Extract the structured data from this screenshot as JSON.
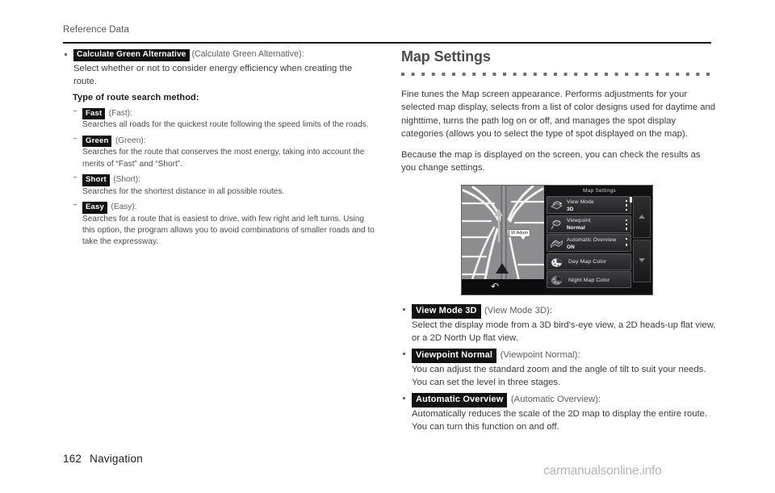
{
  "header": {
    "running_head": "Reference Data"
  },
  "footer": {
    "page_number": "162",
    "section": "Navigation",
    "watermark": "carmanualsonline.info"
  },
  "left_column": {
    "bullet": {
      "chip": "Calculate Green Alternative",
      "paren": "(Calculate Green Alternative):",
      "description": "Select whether or not to consider energy efficiency when creating the route."
    },
    "subheading": "Type of route search method:",
    "methods": [
      {
        "chip": "Fast",
        "paren": "(Fast):",
        "description": "Searches all roads for the quickest route following the speed limits of the roads."
      },
      {
        "chip": "Green",
        "paren": "(Green):",
        "description": "Searches for the route that conserves the most energy, taking into account the merits of “Fast” and “Short”."
      },
      {
        "chip": "Short",
        "paren": "(Short):",
        "description": "Searches for the shortest distance in all possible routes."
      },
      {
        "chip": "Easy",
        "paren": "(Easy):",
        "description": "Searches for a route that is easiest to drive, with few right and left turns. Using this option, the program allows you to avoid combinations of smaller roads and to take the expressway."
      }
    ]
  },
  "right_column": {
    "section_title": "Map Settings",
    "intro_paragraphs": [
      "Fine tunes the Map screen appearance. Performs adjustments for your selected map display, selects from a list of color designs used for daytime and nighttime, turns the path log on or off, and manages the spot display categories (allows you to select the type of spot displayed on the map).",
      "Because the map is displayed on the screen, you can check the results as you change settings."
    ],
    "bullets": [
      {
        "chip": "View Mode 3D",
        "paren": "(View Mode 3D):",
        "description": "Select the display mode from a 3D bird's-eye view, a 2D heads-up flat view, or a 2D North Up flat view."
      },
      {
        "chip": "Viewpoint Normal",
        "paren": "(Viewpoint Normal):",
        "description": "You can adjust the standard zoom and the angle of tilt to suit your needs. You can set the level in three stages."
      },
      {
        "chip": "Automatic Overview",
        "paren": "(Automatic Overview):",
        "description": "Automatically reduces the scale of the 2D map to display the entire route. You can turn this function on and off."
      }
    ]
  },
  "screenshot": {
    "title": "Map Settings",
    "map_street_label": "W Adam",
    "back_icon": "↶",
    "menu_items": [
      {
        "label": "View Mode",
        "value": "3D",
        "icon": "view-mode-icon"
      },
      {
        "label": "Viewpoint",
        "value": "Normal",
        "icon": "viewpoint-icon"
      },
      {
        "label": "Automatic Overview",
        "value": "ON",
        "icon": "automatic-overview-icon"
      },
      {
        "label": "Day Map Color",
        "value": "",
        "icon": "day-map-color-icon"
      },
      {
        "label": "Night Map Color",
        "value": "",
        "icon": "night-map-color-icon"
      }
    ]
  },
  "colors": {
    "rule": "#1a1a1a",
    "chip_bg": "#111113",
    "text": "#3b3b3d",
    "heading": "#4b4b4d",
    "watermark": "#b6b6b8"
  }
}
